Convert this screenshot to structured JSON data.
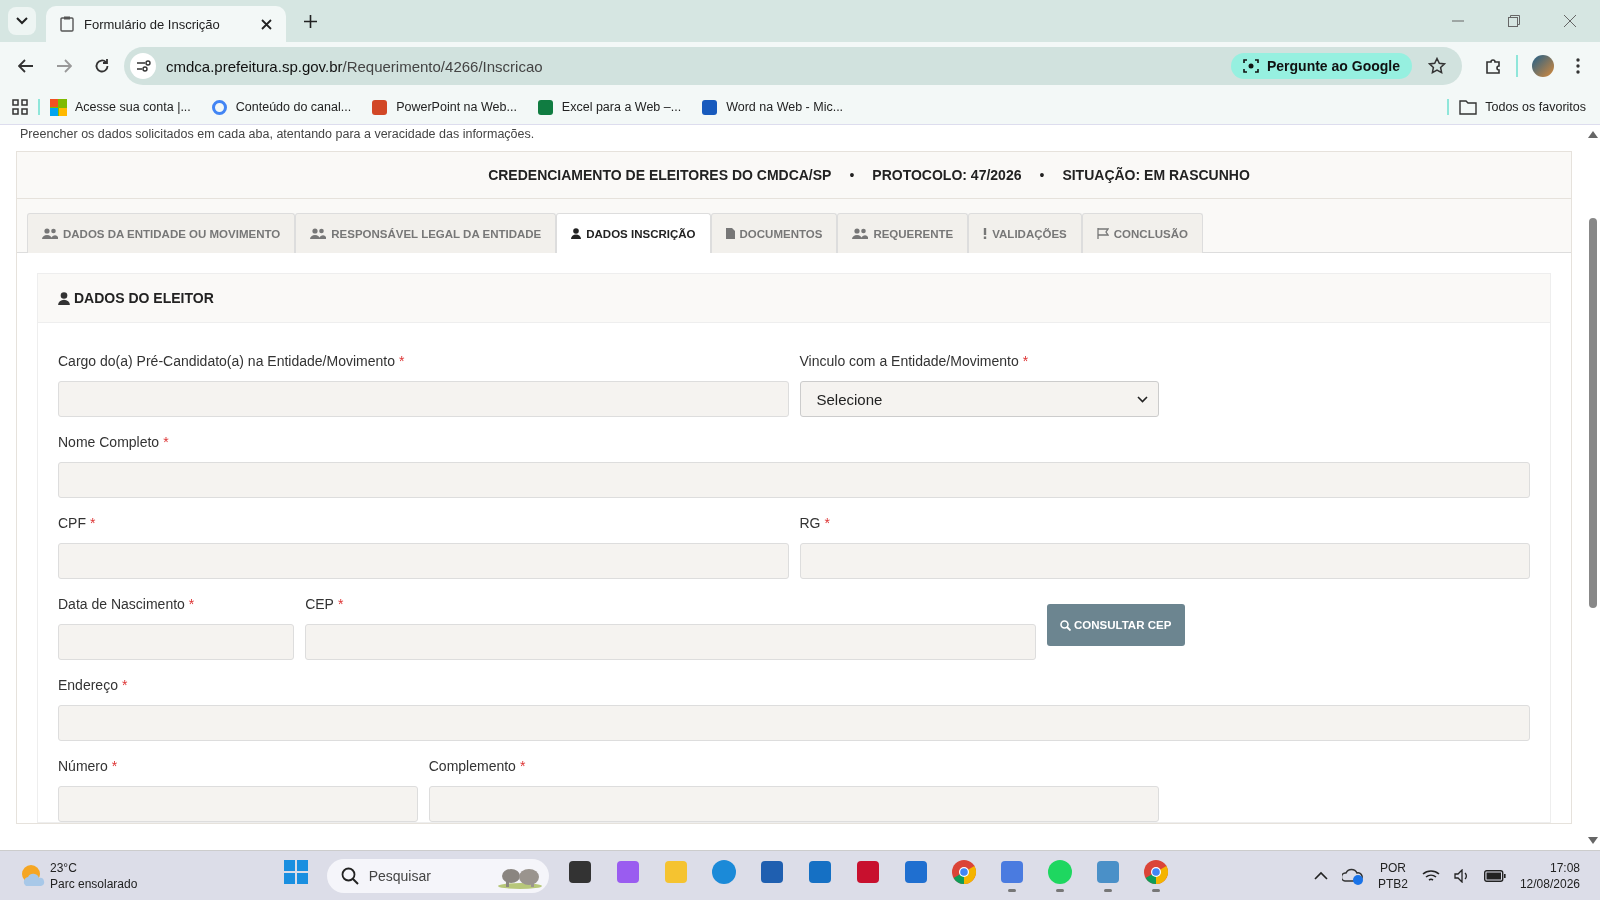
{
  "browser": {
    "tab_title": "Formulário de Inscrição",
    "url_host": "cmdca.prefeitura.sp.gov.br",
    "url_path": "/Requerimento/4266/Inscricao",
    "ask_google": "Pergunte ao Google",
    "bookmarks": [
      {
        "kind": "ms",
        "label": "Acesse sua conta |..."
      },
      {
        "kind": "google",
        "label": "Conteúdo do canal..."
      },
      {
        "kind": "ppt",
        "label": "PowerPoint na Web..."
      },
      {
        "kind": "excel",
        "label": "Excel para a Web –..."
      },
      {
        "kind": "word",
        "label": "Word na Web - Mic..."
      }
    ],
    "all_bookmarks": "Todos os favoritos"
  },
  "page": {
    "intro": "Preencher os dados solicitados em cada aba, atentando para a veracidade das informações.",
    "header": [
      "CREDENCIAMENTO DE ELEITORES DO CMDCA/SP",
      "•",
      "PROTOCOLO: 47/2026",
      "•",
      "SITUAÇÃO: EM RASCUNHO"
    ],
    "tabs": [
      {
        "kind": "users",
        "label": "DADOS DA ENTIDADE OU MOVIMENTO",
        "selected": false
      },
      {
        "kind": "users",
        "label": "RESPONSÁVEL LEGAL DA ENTIDADE",
        "selected": false
      },
      {
        "kind": "user",
        "label": "DADOS INSCRIÇÃO",
        "selected": true
      },
      {
        "kind": "file",
        "label": "DOCUMENTOS",
        "selected": false
      },
      {
        "kind": "users",
        "label": "REQUERENTE",
        "selected": false
      },
      {
        "kind": "exclaim",
        "label": "VALIDAÇÕES",
        "selected": false
      },
      {
        "kind": "flag",
        "label": "CONCLUSÃO",
        "selected": false
      }
    ],
    "section_title": "DADOS DO ELEITOR",
    "rows": [
      [
        {
          "kind": "input",
          "label": "Cargo do(a) Pré-Candidato(a) na Entidade/Movimento",
          "required_mark": "*"
        },
        {
          "kind": "select",
          "label": "Vinculo com a Entidade/Movimento",
          "required_mark": "*",
          "value": "Selecione"
        }
      ],
      [
        {
          "kind": "input",
          "label": "Nome Completo",
          "required_mark": "*"
        }
      ],
      [
        {
          "kind": "input",
          "label": "CPF",
          "required_mark": "*"
        },
        {
          "kind": "input",
          "label": "RG",
          "required_mark": "*"
        }
      ],
      [
        {
          "kind": "input",
          "label": "Data de Nascimento",
          "required_mark": "*"
        },
        {
          "kind": "input",
          "label": "CEP",
          "required_mark": "*"
        },
        {
          "kind": "button",
          "label": "CONSULTAR CEP"
        }
      ],
      [
        {
          "kind": "input",
          "label": "Endereço",
          "required_mark": "*"
        }
      ],
      [
        {
          "kind": "input",
          "label": "Número",
          "required_mark": "*"
        },
        {
          "kind": "input",
          "label": "Complemento",
          "required_mark": "*"
        }
      ]
    ]
  },
  "taskbar": {
    "temperature": "23°C",
    "weather": "Parc ensolarado",
    "search_placeholder": "Pesquisar",
    "apps": [
      {
        "kind": "start",
        "running": false
      },
      {
        "kind": "taskview",
        "running": false
      },
      {
        "kind": "copilot",
        "running": false
      },
      {
        "kind": "folder",
        "running": false
      },
      {
        "kind": "edge",
        "running": false
      },
      {
        "kind": "store",
        "running": false
      },
      {
        "kind": "cube",
        "running": false
      },
      {
        "kind": "shield",
        "running": false
      },
      {
        "kind": "outlook",
        "running": false
      },
      {
        "kind": "chrome",
        "running": false
      },
      {
        "kind": "calendar",
        "running": true
      },
      {
        "kind": "spotify",
        "running": true
      },
      {
        "kind": "paper",
        "running": true
      },
      {
        "kind": "chrome",
        "running": true
      }
    ],
    "language": "POR",
    "layout": "PTB2",
    "time": "17:08",
    "date": "12/08/2026"
  }
}
